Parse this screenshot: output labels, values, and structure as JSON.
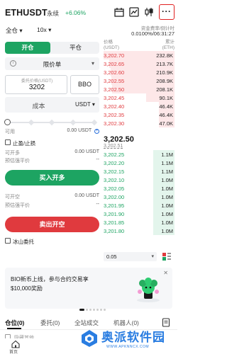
{
  "header": {
    "symbol": "ETHUSDT",
    "type": "永续",
    "change": "+6.06%",
    "icons": [
      "calendar-icon",
      "chart-icon",
      "kline-icon",
      "more-icon"
    ],
    "more_glyph": "···"
  },
  "modes": {
    "margin_mode": "全仓",
    "margin_caret": "▾",
    "leverage": "10x",
    "leverage_caret": "▾"
  },
  "fee": {
    "label": "资金费率/倒计时",
    "value": "0.0100%/06:31:27"
  },
  "trade_tabs": {
    "open": "开仓",
    "close": "平仓"
  },
  "order_form": {
    "info_glyph": "i",
    "order_type": "限价单",
    "order_type_caret": "▾",
    "price_label": "委托价格(USDT)",
    "price_value": "3202",
    "bbo_label": "BBO",
    "cost_label": "成本",
    "cost_unit": "USDT ▾",
    "slider_percent": 0,
    "available_label": "可用",
    "available_value": "0.00 USDT",
    "plus_glyph": "+",
    "tpsl_label": "止盈/止损",
    "can_open_long_label": "可开多",
    "can_open_long_value": "0.00 USDT",
    "est_liq_label_1": "预估强平价",
    "est_liq_value_1": "--",
    "buy_button": "买入开多",
    "can_open_short_label": "可开空",
    "can_open_short_value": "0.00 USDT",
    "est_liq_label_2": "预估强平价",
    "est_liq_value_2": "--",
    "sell_button": "卖出开空",
    "iceberg_label": "冰山委托"
  },
  "order_book": {
    "price_header": "价格",
    "price_unit": "(USDT)",
    "qty_header": "累计",
    "qty_unit": "(ETH)",
    "asks": [
      {
        "price": "3,202.70",
        "qty": "232.8K",
        "depth": 1.0
      },
      {
        "price": "3,202.65",
        "qty": "213.7K",
        "depth": 0.92
      },
      {
        "price": "3,202.60",
        "qty": "210.9K",
        "depth": 0.9
      },
      {
        "price": "3,202.55",
        "qty": "208.9K",
        "depth": 0.89
      },
      {
        "price": "3,202.50",
        "qty": "208.1K",
        "depth": 0.88
      },
      {
        "price": "3,202.45",
        "qty": "90.1K",
        "depth": 0.4
      },
      {
        "price": "3,202.40",
        "qty": "46.4K",
        "depth": 0.22
      },
      {
        "price": "3,202.35",
        "qty": "46.4K",
        "depth": 0.22
      },
      {
        "price": "3,202.30",
        "qty": "47.0K",
        "depth": 0.22
      }
    ],
    "last_price": "3,202.50",
    "mark_price": "3,202.51",
    "bids": [
      {
        "price": "3,202.25",
        "qty": "1.1M",
        "depth": 0.3
      },
      {
        "price": "3,202.20",
        "qty": "1.1M",
        "depth": 0.3
      },
      {
        "price": "3,202.15",
        "qty": "1.1M",
        "depth": 0.3
      },
      {
        "price": "3,202.10",
        "qty": "1.0M",
        "depth": 0.3
      },
      {
        "price": "3,202.05",
        "qty": "1.0M",
        "depth": 0.3
      },
      {
        "price": "3,202.00",
        "qty": "1.0M",
        "depth": 0.3
      },
      {
        "price": "3,201.95",
        "qty": "1.0M",
        "depth": 0.3
      },
      {
        "price": "3,201.90",
        "qty": "1.0M",
        "depth": 0.3
      },
      {
        "price": "3,201.85",
        "qty": "1.0M",
        "depth": 0.3
      },
      {
        "price": "3,201.80",
        "qty": "1.0M",
        "depth": 0.3
      }
    ],
    "depth_step": "0.05",
    "depth_caret": "▾"
  },
  "banner": {
    "line1": "BIO新币上线，参与合约交易享",
    "line2": "$10,000奖励",
    "close_glyph": "✕"
  },
  "position_tabs": [
    {
      "label": "仓位(0)",
      "active": true
    },
    {
      "label": "委托(0)",
      "active": false
    },
    {
      "label": "全站成交",
      "active": false
    },
    {
      "label": "机器人(0)",
      "active": false
    }
  ],
  "hide_others_label": "隐藏其他",
  "bottom_nav": {
    "home_label": "首页"
  },
  "watermark": {
    "text": "奥派软件园",
    "url": "WWW.APKNNCX.COM"
  }
}
